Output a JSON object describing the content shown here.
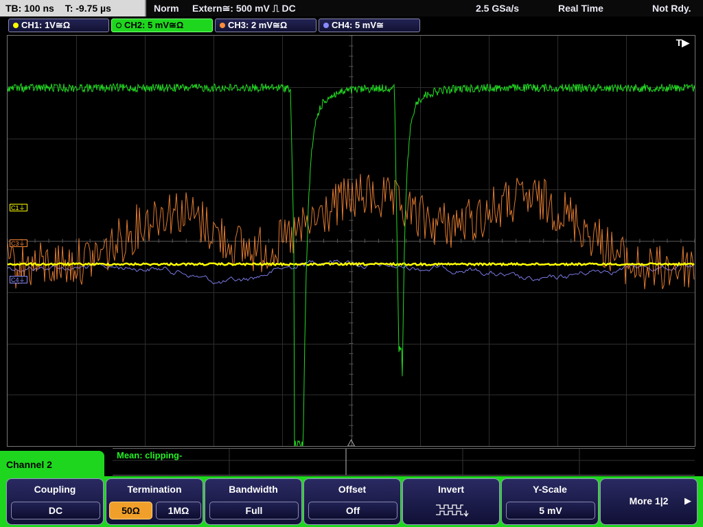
{
  "header": {
    "timebase": "TB: 100 ns",
    "trigger_time": "T: -9.75 µs",
    "trigger_mode": "Norm",
    "trigger_source": "Extern≅: 500 mV ⎍ DC",
    "sample_rate": "2.5 GSa/s",
    "acq_mode": "Real Time",
    "status": "Not Rdy."
  },
  "channels": [
    {
      "label": "CH1: 1V≅Ω",
      "color": "#ffff00",
      "active": false
    },
    {
      "label": "CH2: 5 mV≅Ω",
      "color": "#22dd22",
      "active": true
    },
    {
      "label": "CH3: 2 mV≅Ω",
      "color": "#ff8c3a",
      "active": false
    },
    {
      "label": "CH4: 5 mV≅",
      "color": "#8a8aff",
      "active": false
    }
  ],
  "screen": {
    "trigger_marker": "T▶",
    "markers": [
      {
        "label": "C1⏚",
        "color": "#ffff00"
      },
      {
        "label": "C3⏚",
        "color": "#ff8c3a"
      },
      {
        "label": "C4⏚",
        "color": "#8a8aff"
      }
    ]
  },
  "measurement": {
    "text": "Mean: clipping-"
  },
  "menu": {
    "title": "Channel 2",
    "softkeys": [
      {
        "title": "Coupling",
        "buttons": [
          {
            "label": "DC",
            "selected": false
          }
        ]
      },
      {
        "title": "Termination",
        "buttons": [
          {
            "label": "50Ω",
            "selected": true
          },
          {
            "label": "1MΩ",
            "selected": false
          }
        ]
      },
      {
        "title": "Bandwidth",
        "buttons": [
          {
            "label": "Full",
            "selected": false
          }
        ]
      },
      {
        "title": "Offset",
        "buttons": [
          {
            "label": "Off",
            "selected": false
          }
        ]
      },
      {
        "title": "Invert",
        "icon": "invert-square-wave-icon"
      },
      {
        "title": "Y-Scale",
        "buttons": [
          {
            "label": "5 mV",
            "selected": false
          }
        ]
      },
      {
        "title": "More 1|2",
        "icon": "right-arrow-icon"
      }
    ]
  }
}
